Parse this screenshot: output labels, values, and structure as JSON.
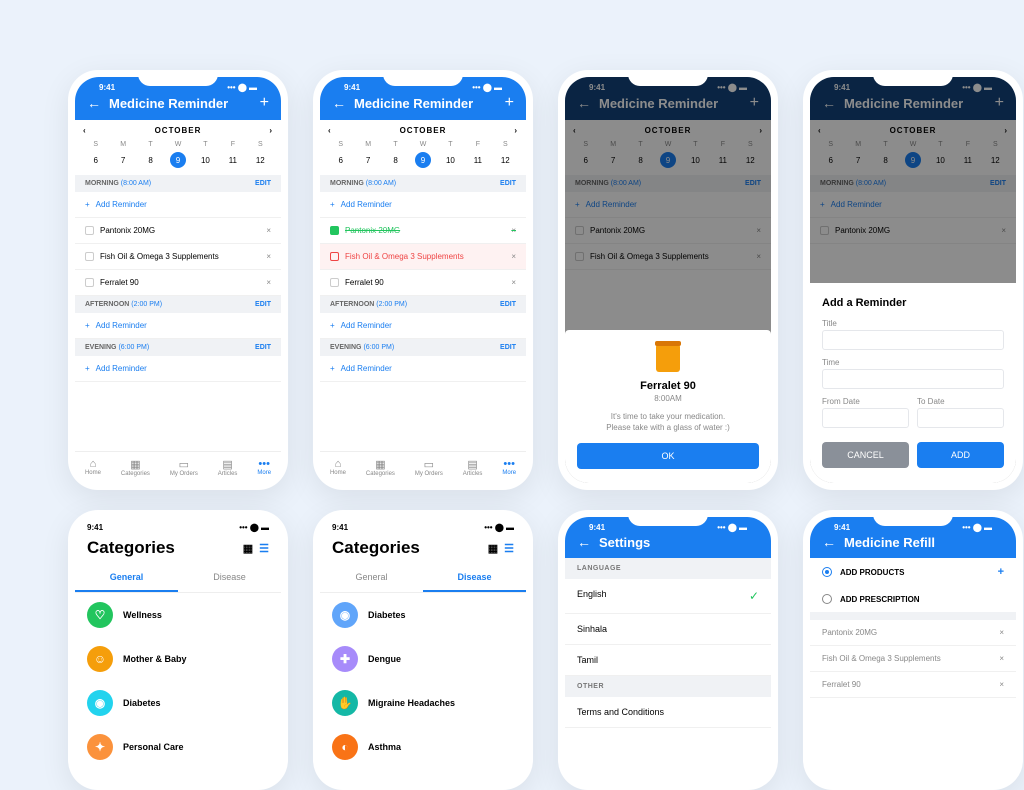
{
  "status_time": "9:41",
  "app_title": "Medicine Reminder",
  "calendar": {
    "month": "OCTOBER",
    "days": [
      "S",
      "M",
      "T",
      "W",
      "T",
      "F",
      "S"
    ],
    "dates": [
      "6",
      "7",
      "8",
      "9",
      "10",
      "11",
      "12"
    ],
    "selected": "9"
  },
  "sections": {
    "morning": {
      "label": "MORNING",
      "time": "(8:00 AM)",
      "edit": "EDIT"
    },
    "afternoon": {
      "label": "AFTERNOON",
      "time": "(2:00 PM)",
      "edit": "EDIT"
    },
    "evening": {
      "label": "EVENING",
      "time": "(6:00 PM)",
      "edit": "EDIT"
    }
  },
  "add_reminder": "Add Reminder",
  "meds": {
    "pantonix": "Pantonix 20MG",
    "fishoil": "Fish Oil & Omega 3 Supplements",
    "ferralet": "Ferralet 90"
  },
  "tabbar": [
    "Home",
    "Categories",
    "My Orders",
    "Articles",
    "More"
  ],
  "alert": {
    "name": "Ferralet 90",
    "time": "8:00AM",
    "msg1": "It's time to take your medication.",
    "msg2": "Please take with a glass of water :)",
    "ok": "OK"
  },
  "add_sheet": {
    "title": "Add a Reminder",
    "f_title": "Title",
    "f_time": "Time",
    "f_from": "From Date",
    "f_to": "To Date",
    "cancel": "CANCEL",
    "add": "ADD"
  },
  "categories": {
    "title": "Categories",
    "tab_general": "General",
    "tab_disease": "Disease",
    "general": [
      "Wellness",
      "Mother & Baby",
      "Diabetes",
      "Personal Care"
    ],
    "disease": [
      "Diabetes",
      "Dengue",
      "Migraine Headaches",
      "Asthma"
    ]
  },
  "settings": {
    "title": "Settings",
    "lang_label": "LANGUAGE",
    "langs": [
      "English",
      "Sinhala",
      "Tamil"
    ],
    "other_label": "OTHER",
    "terms": "Terms and Conditions"
  },
  "refill": {
    "title": "Medicine Refill",
    "add_products": "ADD PRODUCTS",
    "add_prescription": "ADD PRESCRIPTION",
    "items": [
      "Pantonix 20MG",
      "Fish Oil & Omega 3 Supplements",
      "Ferralet 90"
    ]
  },
  "colors": {
    "green": "#22c55e",
    "amber": "#f59e0b",
    "cyan": "#22d3ee",
    "orange": "#fb923c",
    "blue": "#60a5fa",
    "purple": "#a78bfa",
    "teal": "#14b8a6",
    "orange2": "#f97316"
  }
}
